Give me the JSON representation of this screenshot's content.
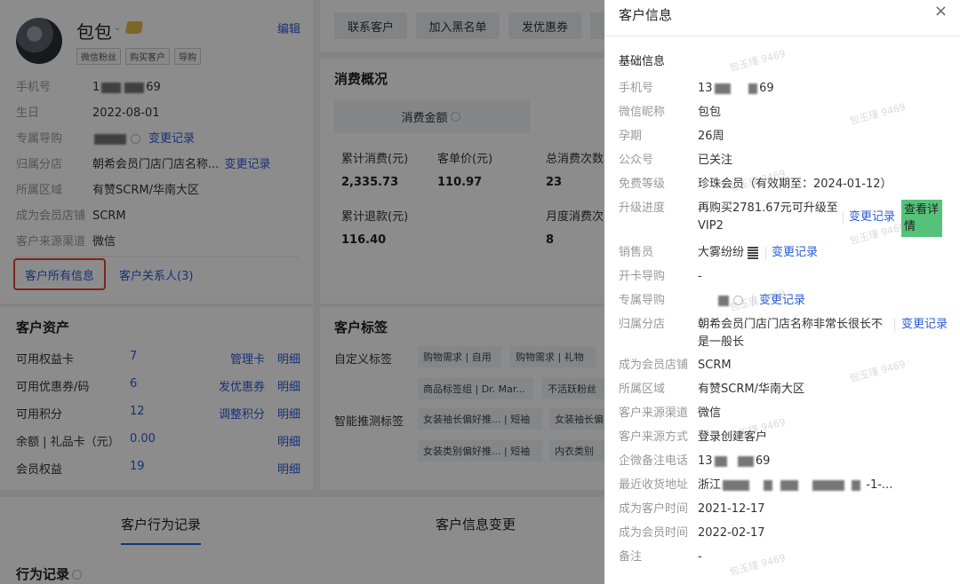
{
  "profile": {
    "name": "包包",
    "edit": "编辑",
    "tags": [
      "微信粉丝",
      "购买客户",
      "导购"
    ],
    "rows": [
      {
        "key": "手机号",
        "value": "1",
        "value_suffix": "69",
        "link": ""
      },
      {
        "key": "生日",
        "value": "2022-08-01",
        "link": ""
      },
      {
        "key": "专属导购",
        "value": "",
        "link": "变更记录"
      },
      {
        "key": "归属分店",
        "value": "朝希会员门店门店名称...",
        "link": "变更记录"
      },
      {
        "key": "所属区域",
        "value": "有赞SCRM/华南大区",
        "link": ""
      },
      {
        "key": "成为会员店铺",
        "value": "SCRM",
        "link": ""
      },
      {
        "key": "客户来源渠道",
        "value": "微信",
        "link": ""
      }
    ],
    "tab_all_info": "客户所有信息",
    "tab_contacts": "客户关系人(3)"
  },
  "assets": {
    "title": "客户资产",
    "rows": [
      {
        "key": "可用权益卡",
        "num": "7",
        "link1": "管理卡",
        "link2": "明细"
      },
      {
        "key": "可用优惠券/码",
        "num": "6",
        "link1": "发优惠券",
        "link2": "明细"
      },
      {
        "key": "可用积分",
        "num": "12",
        "link1": "调整积分",
        "link2": "明细"
      },
      {
        "key": "余额 | 礼品卡（元）",
        "num": "0.00",
        "link1": "",
        "link2": "明细"
      },
      {
        "key": "会员权益",
        "num": "19",
        "link1": "",
        "link2": "明细"
      }
    ]
  },
  "actions": [
    "联系客户",
    "加入黑名单",
    "发优惠券"
  ],
  "overview": {
    "title": "消费概况",
    "header": "消费金额",
    "stats": [
      {
        "label": "累计消费(元)",
        "value": "2,335.73"
      },
      {
        "label": "客单价(元)",
        "value": "110.97"
      },
      {
        "label": "总消费次数",
        "value": "23"
      },
      {
        "label": "累计退款(元)",
        "value": "116.40"
      },
      {
        "label": "月度消费次",
        "value": "8"
      }
    ]
  },
  "tags_section": {
    "title": "客户标签",
    "custom_label": "自定义标签",
    "custom_tags": [
      "购物需求",
      "自用",
      "购物需求",
      "礼物",
      "商品标签组",
      "Dr. Mar...",
      "不活跃粉丝"
    ],
    "smart_label": "智能推测标签",
    "smart_tags": [
      "女装袖长偏好推...",
      "短袖",
      "女装袖长偏",
      "女装类别偏好推...",
      "短袖",
      "内衣类别"
    ]
  },
  "bottom": {
    "tab1": "客户行为记录",
    "tab2": "客户信息变更",
    "sub": "行为记录"
  },
  "drawer": {
    "title": "客户信息",
    "close": "×",
    "section": "基础信息",
    "fields": [
      {
        "key": "手机号",
        "value": "13",
        "value_suffix": "69"
      },
      {
        "key": "微信昵称",
        "value": "包包"
      },
      {
        "key": "孕期",
        "value": "26周"
      },
      {
        "key": "公众号",
        "value": "已关注"
      },
      {
        "key": "免费等级",
        "value": "珍珠会员（有效期至：2024-01-12）"
      },
      {
        "key": "升级进度",
        "value": "再购买2781.67元可升级至",
        "value2": "VIP2",
        "link": "变更记录",
        "button": "查看详情"
      },
      {
        "key": "销售员",
        "value": "大雾纷纷",
        "link": "变更记录"
      },
      {
        "key": "开卡导购",
        "value": "-"
      },
      {
        "key": "专属导购",
        "value": "",
        "link": "变更记录"
      },
      {
        "key": "归属分店",
        "value": "朝希会员门店门店名称非常长很长不",
        "value2": "是一般长",
        "link": "变更记录"
      },
      {
        "key": "成为会员店铺",
        "value": "SCRM"
      },
      {
        "key": "所属区域",
        "value": "有赞SCRM/华南大区"
      },
      {
        "key": "客户来源渠道",
        "value": "微信"
      },
      {
        "key": "客户来源方式",
        "value": "登录创建客户"
      },
      {
        "key": "企微备注电话",
        "value": "13",
        "value_suffix": "69"
      },
      {
        "key": "最近收货地址",
        "value": "浙江",
        "value_suffix": "-1-..."
      },
      {
        "key": "成为客户时间",
        "value": "2021-12-17"
      },
      {
        "key": "成为会员时间",
        "value": "2022-02-17"
      },
      {
        "key": "备注",
        "value": "-"
      }
    ]
  },
  "watermark": "包玉瑾 9469"
}
